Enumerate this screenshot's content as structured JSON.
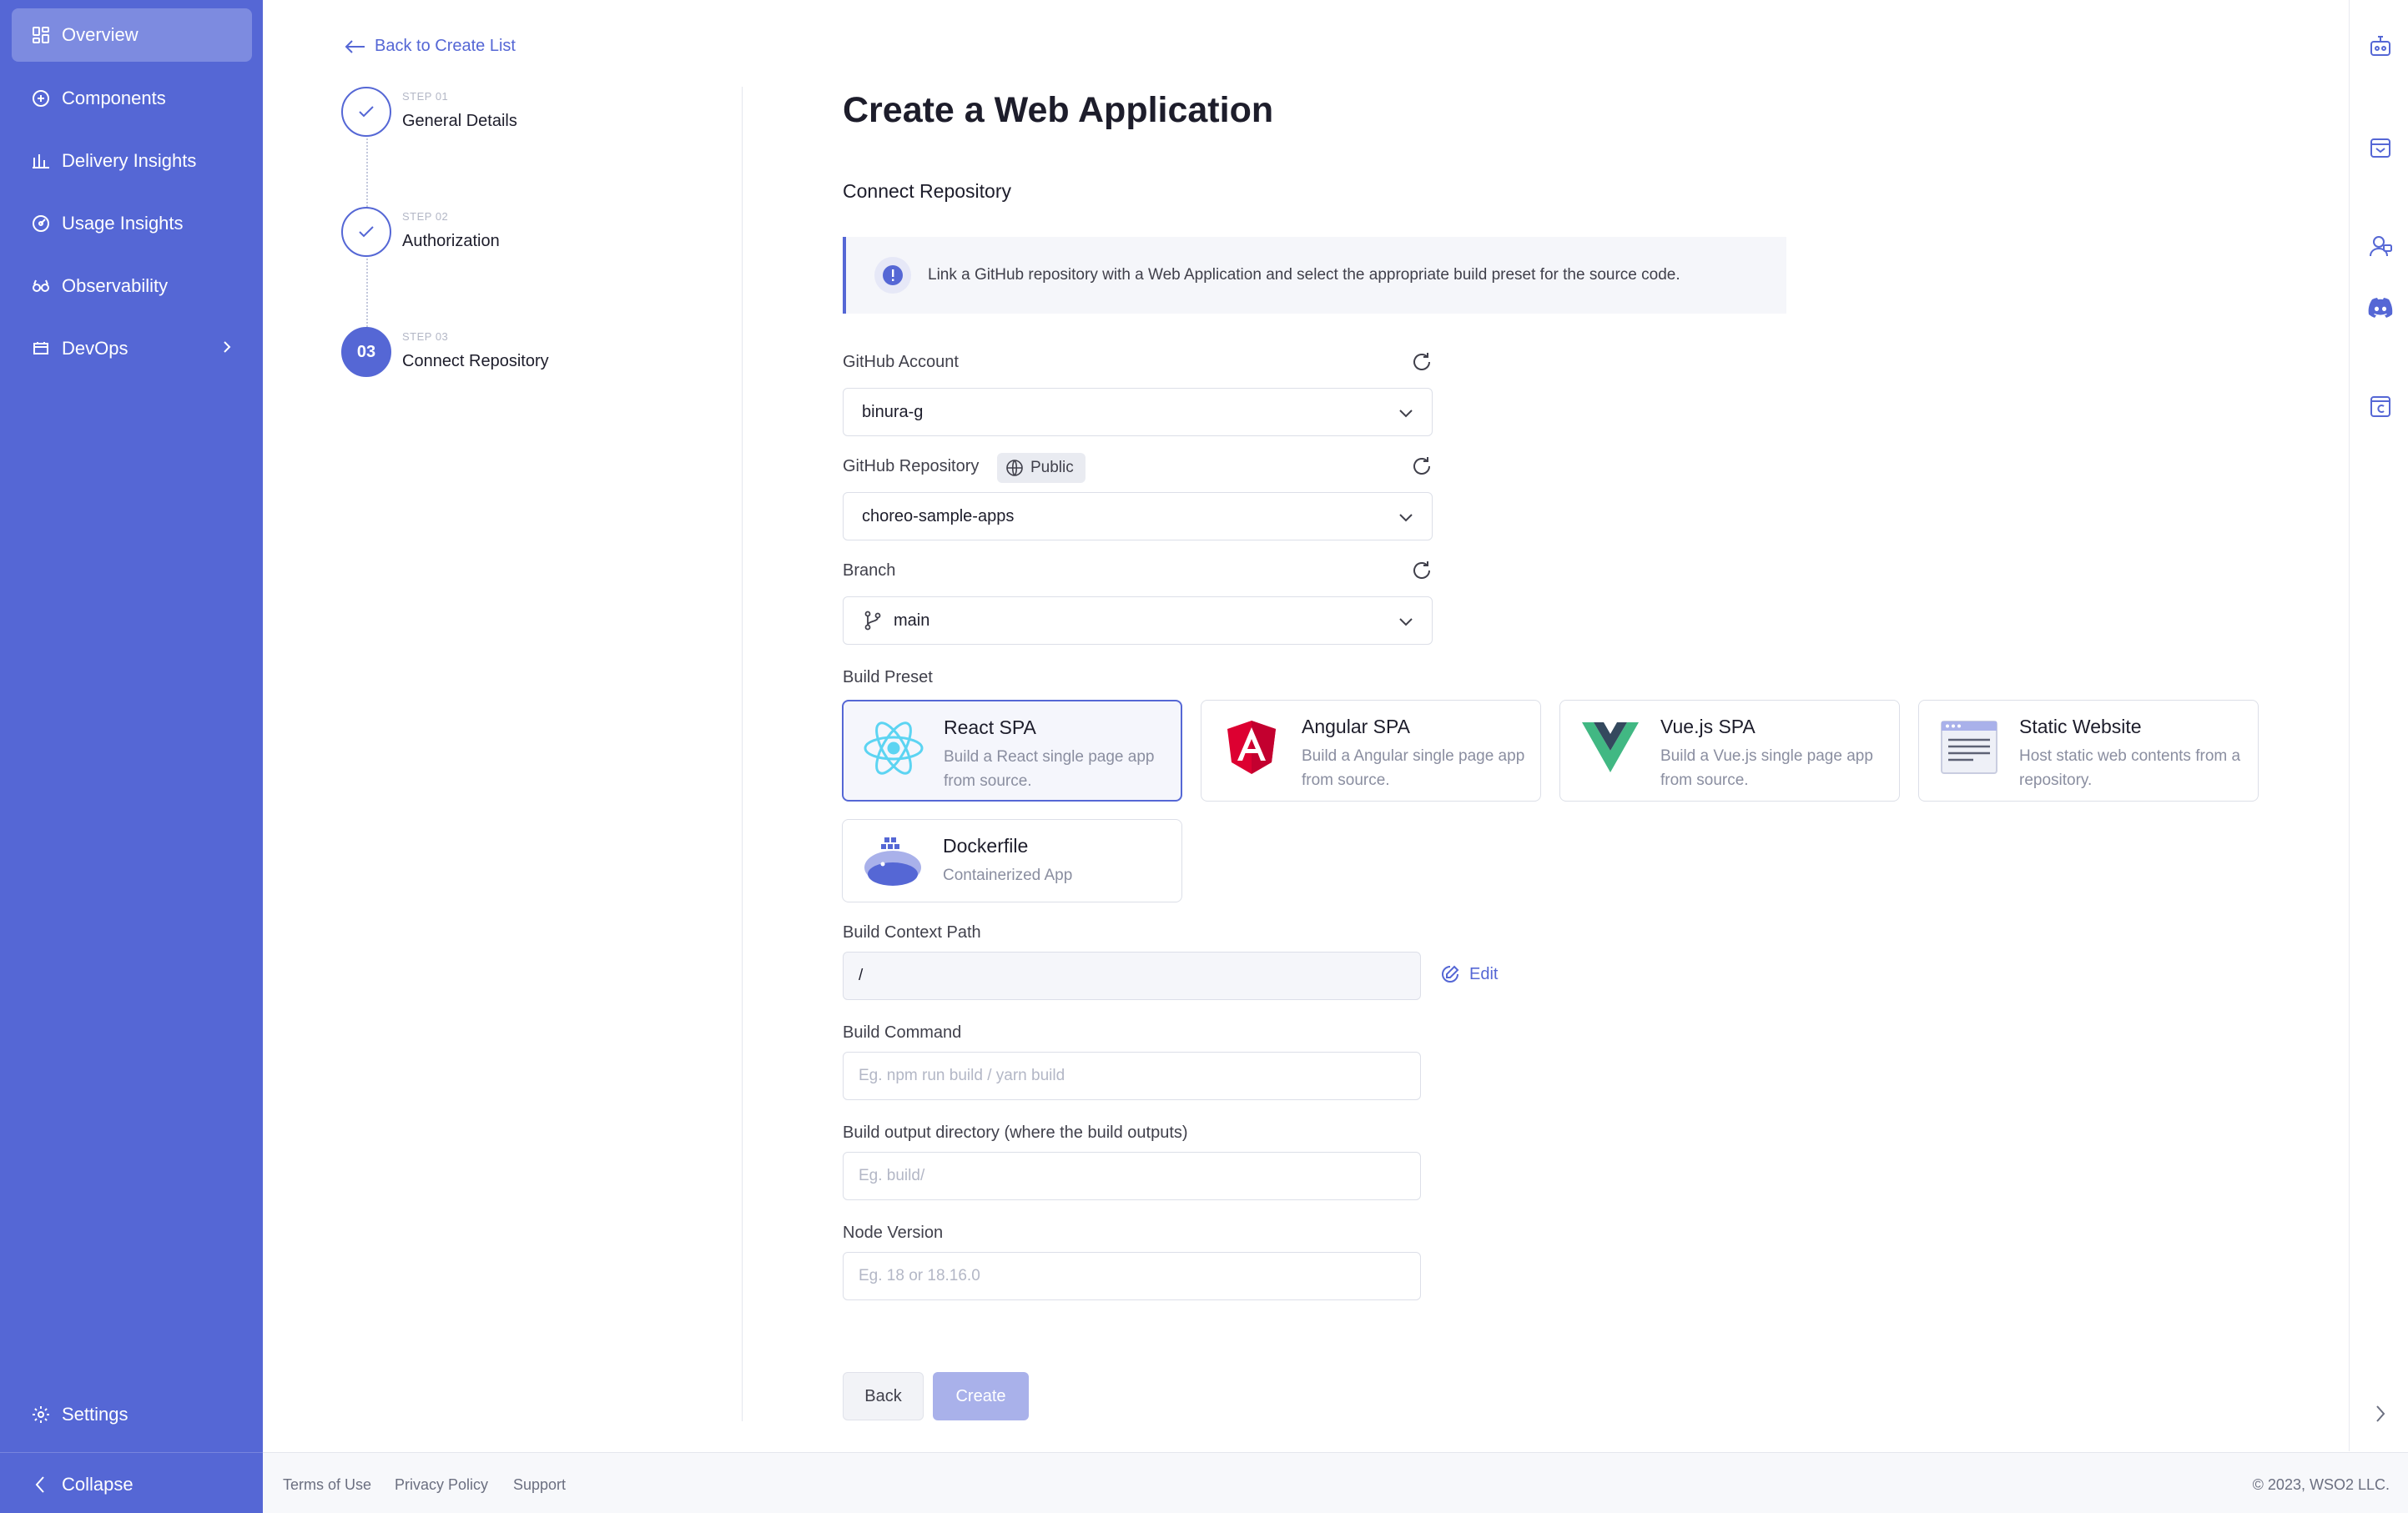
{
  "sidebar": {
    "items": [
      {
        "label": "Overview",
        "icon": "overview-icon",
        "active": true
      },
      {
        "label": "Components",
        "icon": "components-icon"
      },
      {
        "label": "Delivery Insights",
        "icon": "bar-chart-icon"
      },
      {
        "label": "Usage Insights",
        "icon": "usage-icon"
      },
      {
        "label": "Observability",
        "icon": "observability-icon"
      },
      {
        "label": "DevOps",
        "icon": "devops-icon",
        "has_chevron": true
      }
    ],
    "settings_label": "Settings",
    "collapse_label": "Collapse"
  },
  "stepper": {
    "back_label": "Back to Create List",
    "steps": [
      {
        "small": "STEP 01",
        "title": "General Details",
        "state": "done"
      },
      {
        "small": "STEP 02",
        "title": "Authorization",
        "state": "done"
      },
      {
        "small": "STEP 03",
        "title": "Connect Repository",
        "state": "current",
        "number": "03"
      }
    ]
  },
  "form": {
    "title": "Create a Web Application",
    "section_title": "Connect Repository",
    "info_text": "Link a GitHub repository with a Web Application and select the appropriate build preset for the source code.",
    "github_account": {
      "label": "GitHub Account",
      "value": "binura-g"
    },
    "github_repository": {
      "label": "GitHub Repository",
      "badge": "Public",
      "value": "choreo-sample-apps"
    },
    "branch": {
      "label": "Branch",
      "value": "main"
    },
    "build_preset_label": "Build Preset",
    "presets": [
      {
        "title": "React SPA",
        "desc": "Build a React single page app from source.",
        "selected": true
      },
      {
        "title": "Angular SPA",
        "desc": "Build a Angular single page app from source."
      },
      {
        "title": "Vue.js SPA",
        "desc": "Build a Vue.js single page app from source."
      },
      {
        "title": "Static Website",
        "desc": "Host static web contents from a repository."
      },
      {
        "title": "Dockerfile",
        "desc": "Containerized App"
      }
    ],
    "build_context": {
      "label": "Build Context Path",
      "value": "/",
      "edit_label": "Edit"
    },
    "build_command": {
      "label": "Build Command",
      "placeholder": "Eg. npm run build / yarn build"
    },
    "build_output": {
      "label": "Build output directory (where the build outputs)",
      "placeholder": "Eg. build/"
    },
    "node_version": {
      "label": "Node Version",
      "placeholder": "Eg. 18 or 18.16.0"
    },
    "back_button": "Back",
    "create_button": "Create"
  },
  "footer": {
    "terms": "Terms of Use",
    "privacy": "Privacy Policy",
    "support": "Support",
    "copyright": "© 2023, WSO2 LLC."
  },
  "colors": {
    "accent": "#5567d5",
    "sidebar": "#5567d5"
  }
}
